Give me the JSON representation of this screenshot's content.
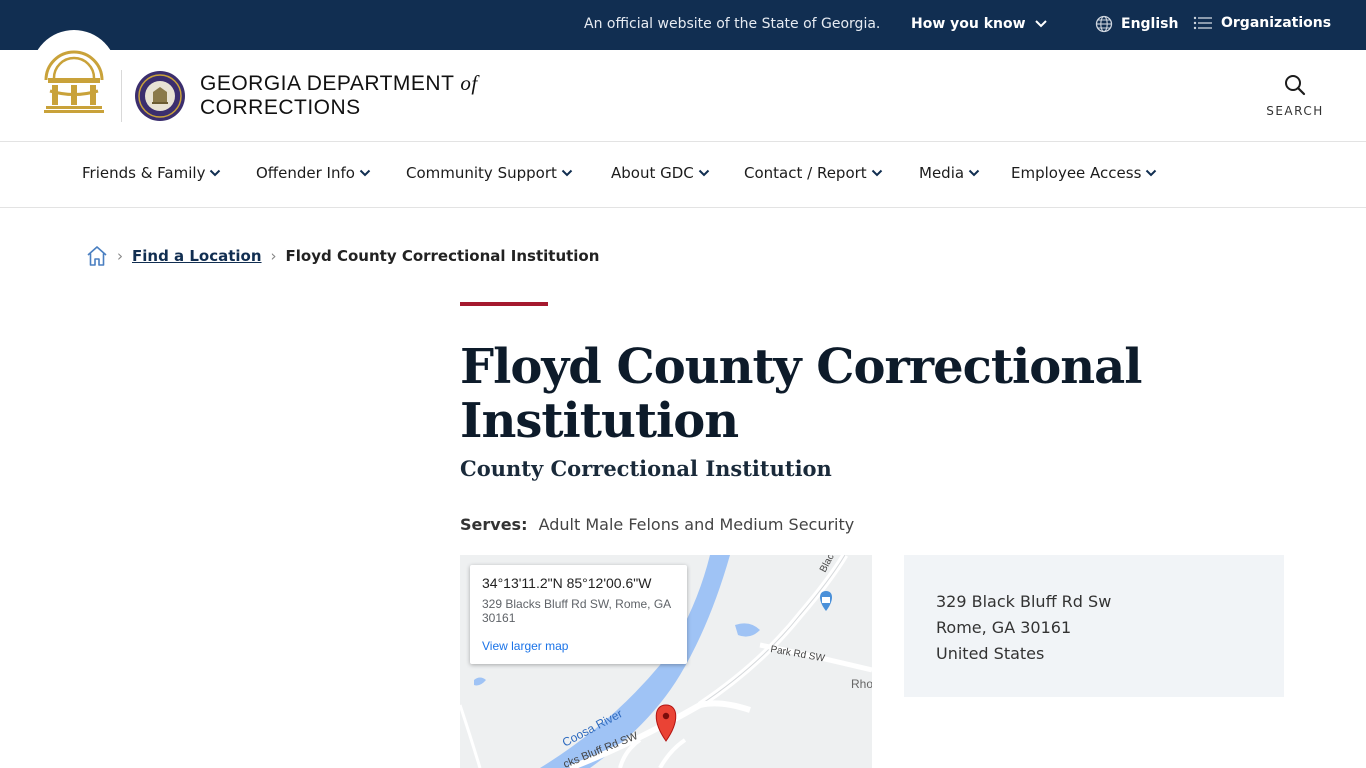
{
  "topbar": {
    "official_text": "An official website of the State of Georgia.",
    "how_you_know": "How you know",
    "language": "English",
    "organizations": "Organizations"
  },
  "header": {
    "title_line1": "GEORGIA DEPARTMENT",
    "title_of": "of",
    "title_line2": "CORRECTIONS",
    "search_label": "SEARCH"
  },
  "nav": {
    "items": [
      {
        "label": "Friends & Family"
      },
      {
        "label": "Offender Info"
      },
      {
        "label": "Community Support"
      },
      {
        "label": "About GDC"
      },
      {
        "label": "Contact / Report"
      },
      {
        "label": "Media"
      },
      {
        "label": "Employee Access"
      }
    ]
  },
  "breadcrumb": {
    "link": "Find a Location",
    "current": "Floyd County Correctional Institution"
  },
  "page": {
    "title": "Floyd County Correctional Institution",
    "subtitle": "County Correctional Institution",
    "serves_label": "Serves:",
    "serves_value": "Adult Male Felons and Medium Security"
  },
  "map": {
    "coords": "34°13'11.2\"N 85°12'00.6\"W",
    "address": "329 Blacks Bluff Rd SW, Rome, GA 30161",
    "view_larger": "View larger map",
    "labels": {
      "river": "Coosa River",
      "road1": "Park Rd SW",
      "road2": "cks Bluff Rd SW",
      "road3": "Blac",
      "place": "Rho"
    }
  },
  "address": {
    "line1": "329 Black Bluff Rd Sw",
    "line2": "Rome, GA 30161",
    "line3": "United States"
  },
  "colors": {
    "navy": "#112e51",
    "accent_red": "#a5192e",
    "gold": "#c9a23a"
  }
}
